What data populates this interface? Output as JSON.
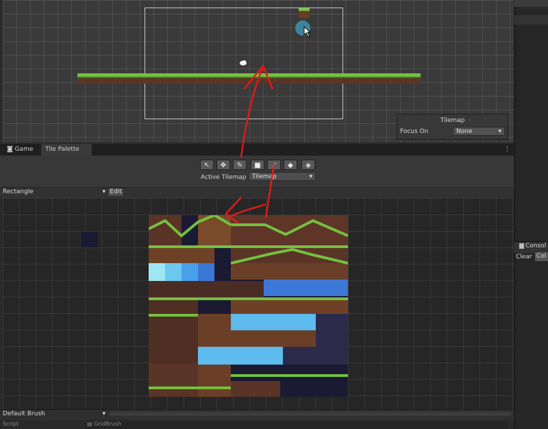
{
  "tabs": {
    "game": "Game",
    "tile_palette": "Tile Palette"
  },
  "scene_overlay": {
    "title": "Tilemap",
    "focus_label": "Focus On",
    "focus_value": "None"
  },
  "toolbar": {
    "tools": [
      "select-icon",
      "move-icon",
      "paint-brush-icon",
      "box-fill-icon",
      "pick-icon",
      "eraser-icon",
      "fill-bucket-icon"
    ],
    "active_tilemap_label": "Active Tilemap",
    "active_tilemap_value": "Tilemap"
  },
  "palette": {
    "selected": "Rectangle",
    "edit_label": "Edit"
  },
  "brush": {
    "selected": "Default Brush"
  },
  "inspector": {
    "script_label": "Script",
    "script_value": "GridBrush"
  },
  "console": {
    "title": "Consol",
    "clear_label": "Clear",
    "collapse_label": "Col"
  },
  "colors": {
    "grass": "#74c040",
    "dirt": "#6b3d22",
    "water": "#4aa0e8",
    "annotation": "#e11a1a"
  }
}
